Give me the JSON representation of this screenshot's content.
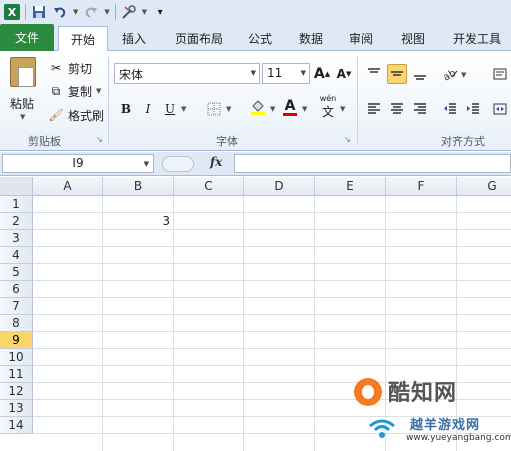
{
  "qat": {
    "app_icon": "excel-logo",
    "app_letter": "X",
    "items": [
      "save-icon",
      "undo-icon",
      "redo-icon",
      "customize-icon"
    ]
  },
  "tabs": [
    {
      "label": "文件",
      "active": false
    },
    {
      "label": "开始",
      "active": true
    },
    {
      "label": "插入",
      "active": false
    },
    {
      "label": "页面布局",
      "active": false
    },
    {
      "label": "公式",
      "active": false
    },
    {
      "label": "数据",
      "active": false
    },
    {
      "label": "审阅",
      "active": false
    },
    {
      "label": "视图",
      "active": false
    },
    {
      "label": "开发工具",
      "active": false
    }
  ],
  "ribbon": {
    "clipboard": {
      "paste": "粘贴",
      "cut": "剪切",
      "copy": "复制",
      "format_painter": "格式刷",
      "group_label": "剪贴板"
    },
    "font": {
      "font_name": "宋体",
      "font_size": "11",
      "bold": "B",
      "italic": "I",
      "underline": "U",
      "grow": "A",
      "shrink": "A",
      "color_letter": "A",
      "wen": "wén",
      "group_label": "字体"
    },
    "alignment": {
      "group_label": "对齐方式"
    }
  },
  "formula_bar": {
    "name_box": "I9",
    "fx": "fx",
    "formula": ""
  },
  "sheet": {
    "columns": [
      "A",
      "B",
      "C",
      "D",
      "E",
      "F",
      "G"
    ],
    "rows": [
      "1",
      "2",
      "3",
      "4",
      "5",
      "6",
      "7",
      "8",
      "9",
      "10",
      "11",
      "12",
      "13",
      "14"
    ],
    "active_row": "9",
    "cells": [
      {
        "ref": "B2",
        "value": "3"
      }
    ]
  },
  "watermark": {
    "title": "酷知网",
    "subtitle": "越羊游戏网",
    "url": "www.yueyangbang.com"
  },
  "colors": {
    "file_tab": "#2a8a3e",
    "active_row_header": "#f9d56a",
    "ribbon_bg": "#dfe9f5"
  }
}
